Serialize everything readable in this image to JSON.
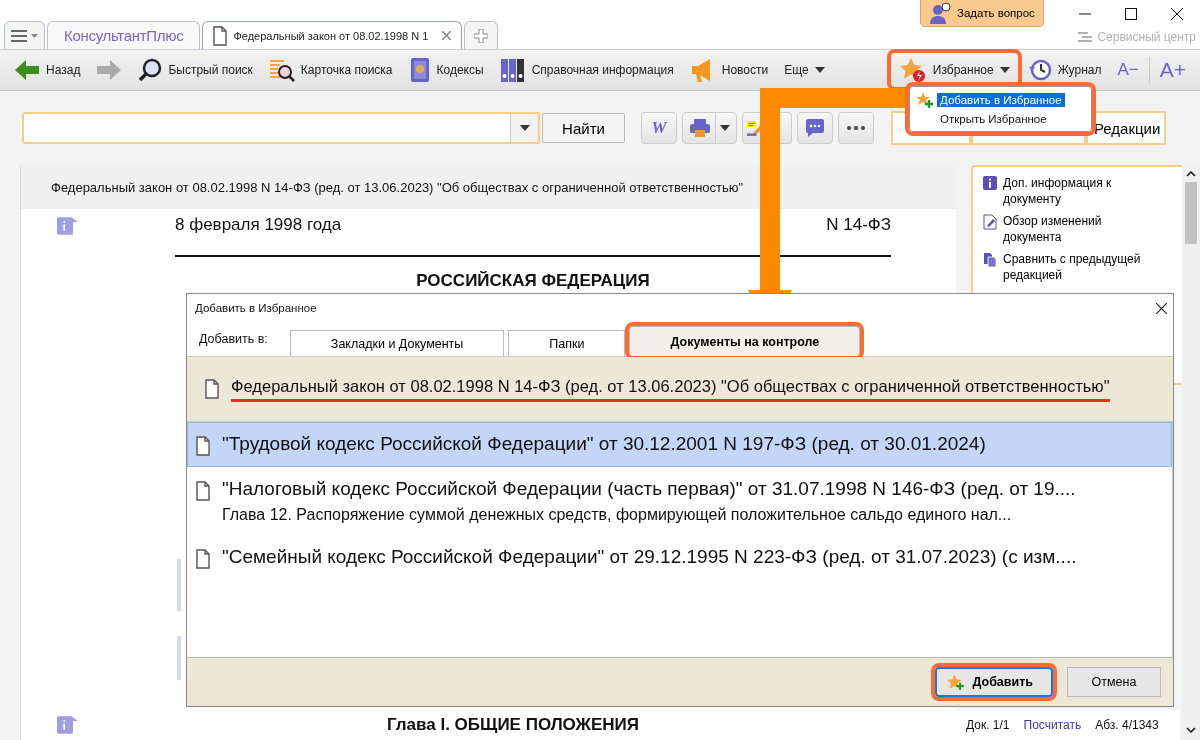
{
  "app": {
    "logo": "КонсультантПлюс",
    "tabs": [
      {
        "title": "Федеральный закон от 08.02.1998 N 1",
        "selected": true
      }
    ],
    "ask_button": "Задать вопрос",
    "service_center": "Сервисный центр"
  },
  "toolbar": [
    {
      "kind": "back",
      "label": "Назад",
      "disabled": false
    },
    {
      "kind": "forward",
      "disabled": true
    },
    {
      "kind": "search",
      "label": "Быстрый поиск"
    },
    {
      "kind": "card",
      "label": "Карточка поиска"
    },
    {
      "kind": "codes",
      "label": "Кодексы"
    },
    {
      "kind": "reference",
      "label": "Справочная информация"
    },
    {
      "kind": "news",
      "label": "Новости"
    },
    {
      "kind": "more",
      "label": "Еще"
    }
  ],
  "favorites": {
    "label": "Избранное",
    "highlighted": true
  },
  "journal": "Журнал",
  "font_smaller": "A−",
  "font_larger": "A+",
  "favorites_menu": {
    "highlighted": true,
    "items": [
      {
        "label": "Добавить в Избранное",
        "selected": true
      },
      {
        "label": "Открыть Избранное",
        "selected": false
      }
    ]
  },
  "search": {
    "button": "Найти"
  },
  "search_tools": [
    {
      "kind": "word",
      "label": "W"
    },
    {
      "kind": "print"
    },
    {
      "kind": "highlight"
    },
    {
      "kind": "comment"
    },
    {
      "kind": "more"
    }
  ],
  "view_buttons": [
    {
      "label": "Редакции"
    }
  ],
  "document": {
    "header": "Федеральный закон от 08.02.1998 N 14-ФЗ (ред. от 13.06.2023) \"Об обществах с ограниченной ответственностью\"",
    "date": "8 февраля 1998 года",
    "number": "N 14-ФЗ",
    "heading": "РОССИЙСКАЯ ФЕДЕРАЦИЯ",
    "chapter": "Глава I. ОБЩИЕ ПОЛОЖЕНИЯ"
  },
  "side_panel": [
    {
      "kind": "info",
      "label": "Доп. информация к документу"
    },
    {
      "kind": "changes",
      "label": "Обзор изменений документа"
    },
    {
      "kind": "compare",
      "label": "Сравнить с предыдущей редакцией"
    }
  ],
  "status": {
    "doc": "Док. 1/1",
    "count_link": "Посчитать",
    "paragraph": "Абз. 4/1343"
  },
  "dialog": {
    "title": "Добавить в Избранное",
    "add_to_label": "Добавить в:",
    "tabs": [
      {
        "label": "Закладки и Документы",
        "selected": false,
        "highlighted": false
      },
      {
        "label": "Папки",
        "selected": false,
        "highlighted": false
      },
      {
        "label": "Документы на контроле",
        "selected": true,
        "highlighted": true
      }
    ],
    "current_document": {
      "title": "Федеральный закон от 08.02.1998 N 14-ФЗ (ред. от 13.06.2023) \"Об обществах с ограниченной ответственностью\"",
      "underlined": true
    },
    "documents": [
      {
        "title": "\"Трудовой кодекс Российской Федерации\" от 30.12.2001 N 197-ФЗ (ред. от 30.01.2024)",
        "selected": true
      },
      {
        "title": "\"Налоговый кодекс Российской Федерации (часть первая)\" от 31.07.1998 N 146-ФЗ (ред. от 19....",
        "subtitle": "Глава 12. Распоряжение суммой денежных средств, формирующей положительное сальдо единого нал...",
        "selected": false
      },
      {
        "title": "\"Семейный кодекс Российской Федерации\" от 29.12.1995 N 223-ФЗ (ред. от 31.07.2023) (с изм....",
        "selected": false
      }
    ],
    "buttons": [
      {
        "kind": "primary",
        "label": "Добавить",
        "highlighted": true
      },
      {
        "kind": "secondary",
        "label": "Отмена",
        "highlighted": false
      }
    ]
  }
}
